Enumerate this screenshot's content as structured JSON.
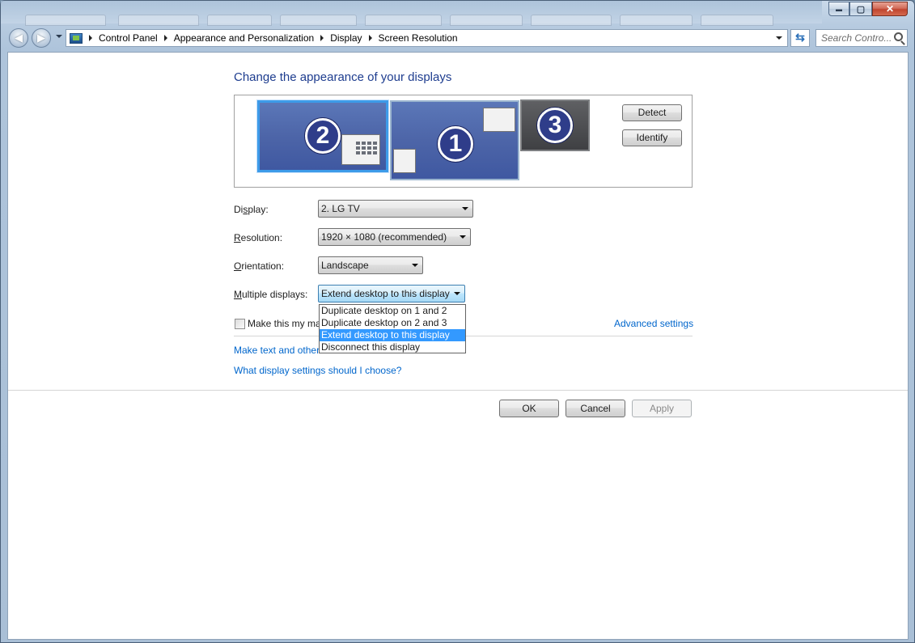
{
  "window": {
    "controls": {
      "minimize": "▬",
      "maximize": "▢",
      "close": "✕"
    }
  },
  "address": {
    "breadcrumbs": [
      "Control Panel",
      "Appearance and Personalization",
      "Display",
      "Screen Resolution"
    ],
    "search_placeholder": "Search Contro..."
  },
  "main": {
    "title": "Change the appearance of your displays",
    "monitors": [
      {
        "number": "2",
        "selected": true
      },
      {
        "number": "1",
        "selected": false
      },
      {
        "number": "3",
        "selected": false
      }
    ],
    "detect_label": "Detect",
    "identify_label": "Identify",
    "fields": {
      "display": {
        "label_pre": "Di",
        "label_u": "s",
        "label_post": "play:",
        "value": "2. LG TV"
      },
      "resolution": {
        "label_pre": "",
        "label_u": "R",
        "label_post": "esolution:",
        "value": "1920 × 1080 (recommended)"
      },
      "orientation": {
        "label_pre": "",
        "label_u": "O",
        "label_post": "rientation:",
        "value": "Landscape"
      },
      "multiple": {
        "label_pre": "",
        "label_u": "M",
        "label_post": "ultiple displays:",
        "value": "Extend desktop to this display"
      }
    },
    "dropdown_options": [
      "Duplicate desktop on 1 and 2",
      "Duplicate desktop on 2 and 3",
      "Extend desktop to this display",
      "Disconnect this display"
    ],
    "dropdown_selected_index": 2,
    "checkbox_label": "Make this my ma",
    "advanced_link": "Advanced settings",
    "link_text_size": "Make text and other",
    "link_which_settings": "What display settings should I choose?",
    "ok_label": "OK",
    "cancel_label": "Cancel",
    "apply_label": "Apply"
  },
  "colors": {
    "title_blue": "#1e3d8f",
    "link_blue": "#0066cc",
    "selection_blue": "#3399ff"
  }
}
